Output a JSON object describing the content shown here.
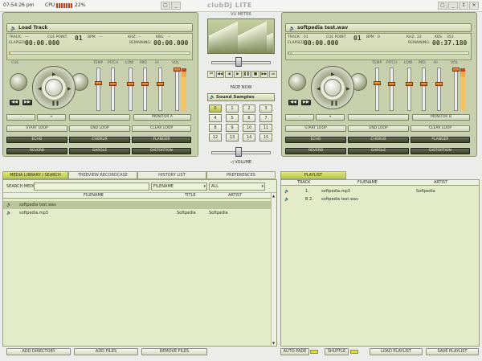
{
  "app": {
    "title": "clubDJ LITE",
    "clock": "07:54:26 pm",
    "cpu_label": "CPU",
    "cpu_pct": "22%",
    "cpu_fraction": 0.22
  },
  "window_buttons": [
    "▢",
    "_",
    "✕"
  ],
  "top_left_buttons": [
    "▢",
    "_"
  ],
  "top_right_buttons": [
    "▢",
    "_",
    "↕",
    "✕"
  ],
  "deckA": {
    "header": "Load Track",
    "track_label": "TRACK:",
    "track": "---",
    "cue_label": "CUE POINT:",
    "cue": "01",
    "bpm_label": "BPM",
    "bpm": "---",
    "khz_label": "KHZ:",
    "khz": "--",
    "kbs_label": "KBS:",
    "kbs": "--",
    "elapsed_label": "ELAPSED:",
    "elapsed": "00:00.000",
    "remaining_label": "REMAINING:",
    "remaining": "00:00.000",
    "cue_knob": "CUE",
    "temp": "TEMP",
    "pitch": "PITCH",
    "low": "LOW",
    "mid": "MID",
    "hi": "HI",
    "vol": "VOL",
    "prog_fraction": 0,
    "minus": "-",
    "plus": "+",
    "monitor": "MONITOR A",
    "start_loop": "START LOOP",
    "end_loop": "END LOOP",
    "clear_loop": "CLEAR LOOP",
    "echo": "ECHO",
    "chorus": "CHORUS",
    "flanger": "FLANGER",
    "reverb": "REVERB",
    "gargle": "GARGLE",
    "distortion": "DISTORTION",
    "rew": "◀◀",
    "fwd": "▶▶",
    "play": "▶",
    "pause": "❚❚",
    "back": "◀",
    "forward": "▶"
  },
  "deckB": {
    "header": "softpedia test.wav",
    "track_label": "TRACK:",
    "track": "01",
    "cue_label": "CUE POINT:",
    "cue": "01",
    "bpm_label": "BPM",
    "bpm": "0",
    "khz_label": "KHZ:",
    "khz": "22",
    "kbs_label": "KBS:",
    "kbs": "353",
    "elapsed_label": "ELAPSED:",
    "elapsed": "00:00.000",
    "remaining_label": "REMAINING:",
    "remaining": "00:37.180",
    "cue_knob": "",
    "temp": "TEMP",
    "pitch": "PITCH",
    "low": "LOW",
    "mid": "MID",
    "hi": "HI",
    "vol": "VOL",
    "prog_fraction": 0.02,
    "minus": "-",
    "plus": "+",
    "monitor": "MONITOR B",
    "start_loop": "START LOOP",
    "end_loop": "END LOOP",
    "clear_loop": "CLEAR LOOP",
    "echo": "ECHO",
    "chorus": "CHORUS",
    "flanger": "FLANGER",
    "reverb": "REVERB",
    "gargle": "GARGLE",
    "distortion": "DISTORTION",
    "rew": "◀◀",
    "fwd": "▶▶",
    "play": "▶",
    "pause": "❚❚",
    "back": "◀",
    "forward": "▶"
  },
  "center": {
    "vu_title": "VU METER",
    "fade_now": "FADE NOW",
    "samples_title": "Sound Samples",
    "samples": [
      "0",
      "1",
      "2",
      "3",
      "4",
      "5",
      "6",
      "7",
      "8",
      "9",
      "10",
      "11",
      "12",
      "13",
      "14",
      "15"
    ],
    "volume_label": "VOLUME",
    "transport": [
      "⏮",
      "◀◀",
      "◀",
      "▶",
      "❚❚",
      "■",
      "▶▶",
      "⏭"
    ]
  },
  "library": {
    "tabs": [
      "MEDIA LIBRARY / SEARCH",
      "TREEVIEW RECORDCASE",
      "HISTORY LIST",
      "PREFERENCES"
    ],
    "search_label": "SEARCH MEDIA:",
    "search_value": "",
    "filter_field": "FILENAME",
    "filter_scope": "ALL",
    "columns": [
      "FILENAME",
      "TITLE",
      "ARTIST"
    ],
    "rows": [
      {
        "filename": "softpedia test.wav",
        "title": "",
        "artist": ""
      },
      {
        "filename": "softpedia.mp3",
        "title": "Softpedia",
        "artist": "Softpedia"
      }
    ]
  },
  "playlist": {
    "tab": "PLAYLIST",
    "columns": [
      "TRACK",
      "FILENAME",
      "ARTIST"
    ],
    "rows": [
      {
        "track": "1.",
        "filename": "softpedia.mp3",
        "artist": "Softpedia"
      },
      {
        "track": "B 2.",
        "filename": "softpedia test.wav",
        "artist": ""
      }
    ]
  },
  "bottom": {
    "add_directory": "ADD DIRECTORY",
    "add_files": "ADD FILES",
    "remove_files": "REMOVE FILES",
    "auto_fade": "AUTO-FADE",
    "shuffle": "SHUFFLE",
    "load_playlist": "LOAD PLAYLIST",
    "save_playlist": "SAVE PLAYLIST"
  }
}
